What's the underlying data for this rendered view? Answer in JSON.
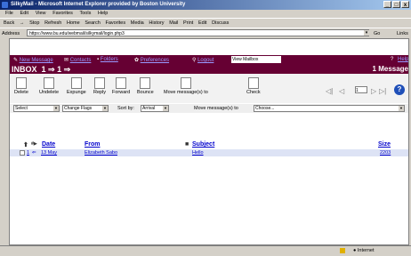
{
  "window": {
    "title": "SilkyMail - Microsoft Internet Explorer provided by Boston University",
    "controls": [
      "_",
      "□",
      "x"
    ]
  },
  "menu": [
    "File",
    "Edit",
    "View",
    "Favorites",
    "Tools",
    "Help"
  ],
  "browser_toolbar": [
    "Back",
    "→",
    "Stop",
    "Refresh",
    "Home",
    "Search",
    "Favorites",
    "Media",
    "History",
    "Mail",
    "Print",
    "Edit",
    "Discuss"
  ],
  "address": {
    "label": "Address",
    "value": "https://www.bu.edu/webmail/silkymail/login.php3",
    "go": "Go",
    "links": "Links"
  },
  "nav": {
    "new_message": "New Message",
    "contacts": "Contacts",
    "folders": "Folders",
    "preferences": "Preferences",
    "logout": "Logout",
    "mailbox_select": "View Mailbox",
    "help_mark": "?",
    "help": "Help"
  },
  "inbox": {
    "title": "INBOX",
    "range": "1 ⇒ 1 ⇒",
    "count": "1 Message"
  },
  "actions": [
    {
      "label": "Delete"
    },
    {
      "label": "Undelete"
    },
    {
      "label": "Expunge"
    },
    {
      "label": "Reply"
    },
    {
      "label": "Forward"
    },
    {
      "label": "Bounce"
    },
    {
      "label": "Move message(s) to"
    },
    {
      "label": "Check"
    }
  ],
  "pager": {
    "first": "◁|",
    "prev": "◁",
    "page": "1",
    "next": "▷",
    "last": "▷|",
    "help": "?"
  },
  "controls": {
    "select": "Select",
    "change_flags": "Change Flags",
    "sort_label": "Sort by:",
    "sort_value": "Arrival",
    "move_label": "Move message(s) to",
    "move_value": "Choose..."
  },
  "table": {
    "headers": {
      "date": "Date",
      "from": "From",
      "subject": "Subject",
      "size": "Size"
    },
    "rows": [
      {
        "num": "1",
        "date": "13 May",
        "from": "Elizabeth Sabo",
        "subject": "Hello",
        "size": "2203"
      }
    ]
  },
  "status": {
    "zone": "Internet"
  }
}
